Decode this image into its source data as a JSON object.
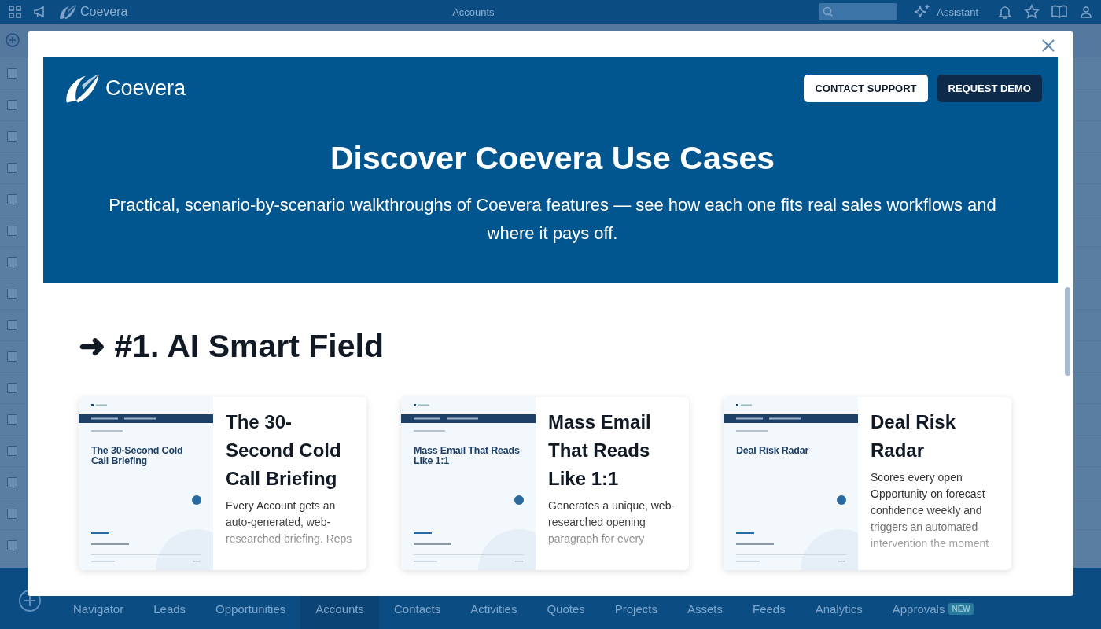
{
  "app_bar": {
    "brand": "Coevera",
    "page_title": "Accounts",
    "assistant_label": "Assistant"
  },
  "list_rows": [
    {
      "checked": false
    },
    {
      "checked": false
    },
    {
      "checked": false
    },
    {
      "checked": false
    },
    {
      "checked": false
    },
    {
      "checked": false
    },
    {
      "checked": false
    },
    {
      "checked": false
    },
    {
      "checked": false
    },
    {
      "checked": false
    },
    {
      "checked": false
    },
    {
      "checked": false
    },
    {
      "checked": false
    },
    {
      "checked": false
    },
    {
      "checked": false
    },
    {
      "checked": false
    }
  ],
  "modal": {
    "brand": "Coevera",
    "buttons": [
      {
        "label": "CONTACT SUPPORT",
        "kind": "secondary"
      },
      {
        "label": "REQUEST DEMO",
        "kind": "primary"
      }
    ],
    "title": "Discover Coevera Use Cases",
    "subtitle": "Practical, scenario-by-scenario walkthroughs of Coevera features — see how each one fits real sales workflows and where it pays off.",
    "section_heading": "➜ #1. AI Smart Field",
    "cards": [
      {
        "thumbnail_title": "The 30-Second Cold Call Briefing",
        "title": "The 30-Second Cold Call Briefing",
        "description": "Every Account gets an auto-generated, web-researched briefing. Reps"
      },
      {
        "thumbnail_title": "Mass Email That Reads Like 1:1",
        "title": "Mass Email That Reads Like 1:1",
        "description": "Generates a unique, web-researched opening paragraph for every"
      },
      {
        "thumbnail_title": "Deal Risk Radar",
        "title": "Deal Risk Radar",
        "description": "Scores every open Opportunity on forecast confidence weekly and triggers an automated intervention the moment"
      }
    ]
  },
  "bottom_nav": {
    "tabs": [
      {
        "label": "Navigator",
        "selected": false
      },
      {
        "label": "Leads",
        "selected": false
      },
      {
        "label": "Opportunities",
        "selected": false
      },
      {
        "label": "Accounts",
        "selected": true
      },
      {
        "label": "Contacts",
        "selected": false
      },
      {
        "label": "Activities",
        "selected": false
      },
      {
        "label": "Quotes",
        "selected": false
      },
      {
        "label": "Projects",
        "selected": false
      },
      {
        "label": "Assets",
        "selected": false
      },
      {
        "label": "Feeds",
        "selected": false
      },
      {
        "label": "Analytics",
        "selected": false
      },
      {
        "label": "Approvals",
        "selected": false,
        "badge": "NEW"
      }
    ]
  }
}
